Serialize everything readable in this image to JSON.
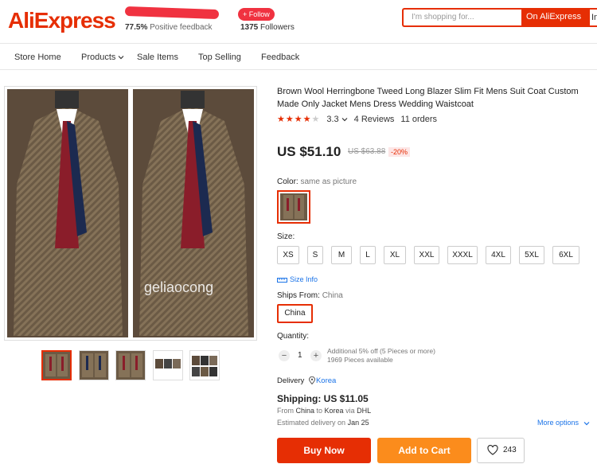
{
  "header": {
    "logo": "AliExpress",
    "feedback_value": "77.5%",
    "feedback_label": "Positive feedback",
    "follow_label": "+ Follow",
    "followers_value": "1375",
    "followers_label": "Followers",
    "search_placeholder": "I'm shopping for...",
    "search_button": "On AliExpress",
    "search_button2": "In"
  },
  "nav": {
    "items": [
      "Store Home",
      "Products",
      "Sale Items",
      "Top Selling",
      "Feedback"
    ]
  },
  "gallery": {
    "watermark": "geliaocong"
  },
  "product": {
    "title": "Brown Wool Herringbone Tweed Long Blazer Slim Fit Mens Suit Coat Custom Made Only Jacket Mens Dress Wedding Waistcoat",
    "rating": "3.3",
    "rating_stars": 3.5,
    "reviews": "4 Reviews",
    "orders": "11 orders",
    "price": "US $51.10",
    "old_price": "US $63.88",
    "discount": "-20%",
    "color_label": "Color:",
    "color_value": "same as picture",
    "size_label": "Size:",
    "sizes": [
      "XS",
      "S",
      "M",
      "L",
      "XL",
      "XXL",
      "XXXL",
      "4XL",
      "5XL",
      "6XL"
    ],
    "size_info": "Size Info",
    "ships_label": "Ships From:",
    "ships_value": "China",
    "ships_option": "China",
    "quantity_label": "Quantity:",
    "quantity_value": "1",
    "qty_note1": "Additional 5% off (5 Pieces or more)",
    "qty_note2": "1969 Pieces available",
    "delivery_label": "Delivery",
    "delivery_location": "Korea",
    "shipping": "Shipping: US $11.05",
    "ship_from": "China",
    "ship_to": "Korea",
    "ship_via": "DHL",
    "estimated_label": "Estimated delivery on",
    "estimated_date": "Jan 25",
    "more_options": "More options",
    "buy_now": "Buy Now",
    "add_to_cart": "Add to Cart",
    "wishlist_count": "243"
  },
  "colors": {
    "accent": "#e62e04",
    "cart": "#fb8c1c",
    "link": "#1a73e8"
  }
}
